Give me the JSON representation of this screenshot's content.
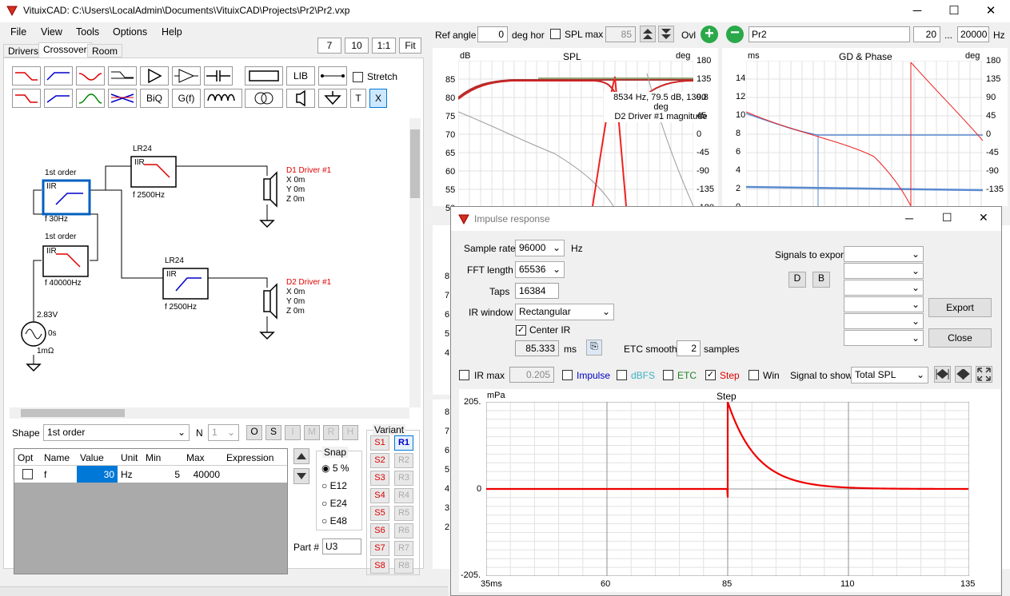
{
  "window": {
    "title": "VituixCAD: C:\\Users\\LocalAdmin\\Documents\\VituixCAD\\Projects\\Pr2\\Pr2.vxp",
    "min": "─",
    "max": "☐",
    "close": "✕"
  },
  "menu": [
    "File",
    "View",
    "Tools",
    "Options",
    "Help"
  ],
  "zoom": {
    "a": "7",
    "b": "10",
    "c": "1:1",
    "d": "Fit"
  },
  "tabs": [
    "Drivers",
    "Crossover",
    "Room"
  ],
  "toolbar": {
    "lib": "LIB",
    "biq": "BiQ",
    "gf": "G(f)",
    "t": "T",
    "x": "X",
    "stretch": "Stretch"
  },
  "schematic": {
    "lr24a": "LR24",
    "iira": "IIR",
    "fa": "f  2500Hz",
    "order1a": "1st order",
    "iirb": "IIR",
    "fb": "f  30Hz",
    "order1b": "1st order",
    "iirc": "IIR",
    "fc": "f  40000Hz",
    "lr24b": "LR24",
    "iird": "IIR",
    "fd": "f  2500Hz",
    "d1": "D1 Driver #1",
    "d1x": "X 0m",
    "d1y": "Y 0m",
    "d1z": "Z 0m",
    "d2": "D2 Driver #1",
    "d2x": "X 0m",
    "d2y": "Y 0m",
    "d2z": "Z 0m",
    "v": "2.83V",
    "s": "0s",
    "r": "1mΩ"
  },
  "shape": {
    "label": "Shape",
    "value": "1st order",
    "n_label": "N",
    "n_value": "1",
    "o": "O",
    "s": "S",
    "i": "I",
    "m": "M",
    "r": "R",
    "h": "H"
  },
  "params": {
    "headers": [
      "Opt",
      "Name",
      "Value",
      "Unit",
      "Min",
      "Max",
      "Expression"
    ],
    "row": [
      "",
      "f",
      "30",
      "Hz",
      "5",
      "40000",
      ""
    ]
  },
  "snap": {
    "label": "Snap",
    "options": [
      "5 %",
      "E12",
      "E24",
      "E48"
    ]
  },
  "variant": {
    "label": "Variant",
    "s": [
      "S1",
      "S2",
      "S3",
      "S4",
      "S5",
      "S6",
      "S7",
      "S8"
    ],
    "r": [
      "R1",
      "R2",
      "R3",
      "R4",
      "R5",
      "R6",
      "R7",
      "R8"
    ]
  },
  "part": {
    "label": "Part #",
    "value": "U3"
  },
  "top_controls": {
    "ref_angle": "Ref angle",
    "angle": "0",
    "deg_hor": "deg hor",
    "spl_max": "SPL max",
    "spl_val": "85",
    "ovl": "Ovl",
    "name": "Pr2",
    "f1": "20",
    "dots": "...",
    "f2": "20000",
    "hz": "Hz"
  },
  "spl_chart": {
    "title": "SPL",
    "yl": "dB",
    "yr": "deg",
    "left_ticks": [
      "85",
      "80",
      "75",
      "70",
      "65",
      "60",
      "55",
      "50"
    ],
    "right_ticks": [
      "180",
      "135",
      "90",
      "45",
      "0",
      "-45",
      "-90",
      "-135",
      "-180"
    ],
    "tooltip1": "8534 Hz, 79.5 dB, 130.8 deg",
    "tooltip2": "D2 Driver #1 magnitude"
  },
  "gd_chart": {
    "title": "GD & Phase",
    "yl": "ms",
    "yr": "deg",
    "left_ticks": [
      "14",
      "12",
      "10",
      "8",
      "6",
      "4",
      "2",
      "0"
    ],
    "right_ticks": [
      "180",
      "135",
      "90",
      "45",
      "0",
      "-45",
      "-90",
      "-135"
    ]
  },
  "left_sliver_ticks": [
    "8",
    "7",
    "6",
    "5",
    "4",
    "8",
    "7",
    "6",
    "5",
    "4",
    "3",
    "2"
  ],
  "dialog": {
    "title": "Impulse response",
    "sample_rate": "Sample rate",
    "sr_val": "96000",
    "hz": "Hz",
    "fft": "FFT length",
    "fft_val": "65536",
    "taps": "Taps",
    "taps_val": "16384",
    "irw": "IR window",
    "irw_val": "Rectangular",
    "center": "Center IR",
    "ms_val": "85.333",
    "ms": "ms",
    "etc_smooth": "ETC smooth",
    "etc_val": "2",
    "samples": "samples",
    "signals": "Signals to export",
    "d": "D",
    "b": "B",
    "export": "Export",
    "close": "Close",
    "irmax": "IR max",
    "irmax_val": "0.205",
    "impulse": "Impulse",
    "dbfs": "dBFS",
    "etc": "ETC",
    "step": "Step",
    "win": "Win",
    "signal_show": "Signal to show",
    "signal_val": "Total SPL"
  },
  "step_chart": {
    "title": "Step",
    "yl": "mPa",
    "y_ticks": [
      "205.",
      "0",
      "-205."
    ],
    "x_ticks": [
      "35ms",
      "60",
      "85",
      "110",
      "135"
    ]
  },
  "chart_data": {
    "type": "line",
    "title": "Step",
    "xlabel": "",
    "ylabel": "mPa",
    "xlim": [
      35,
      135
    ],
    "ylim": [
      -205,
      205
    ],
    "series": [
      {
        "x": [
          35,
          84.9,
          85,
          85.5,
          87,
          90,
          95,
          100,
          105,
          110,
          135
        ],
        "values": [
          0,
          0,
          205,
          180,
          130,
          75,
          30,
          10,
          3,
          0,
          0
        ]
      }
    ]
  },
  "colors": {
    "accent": "#0078d7",
    "red": "#d00000"
  }
}
